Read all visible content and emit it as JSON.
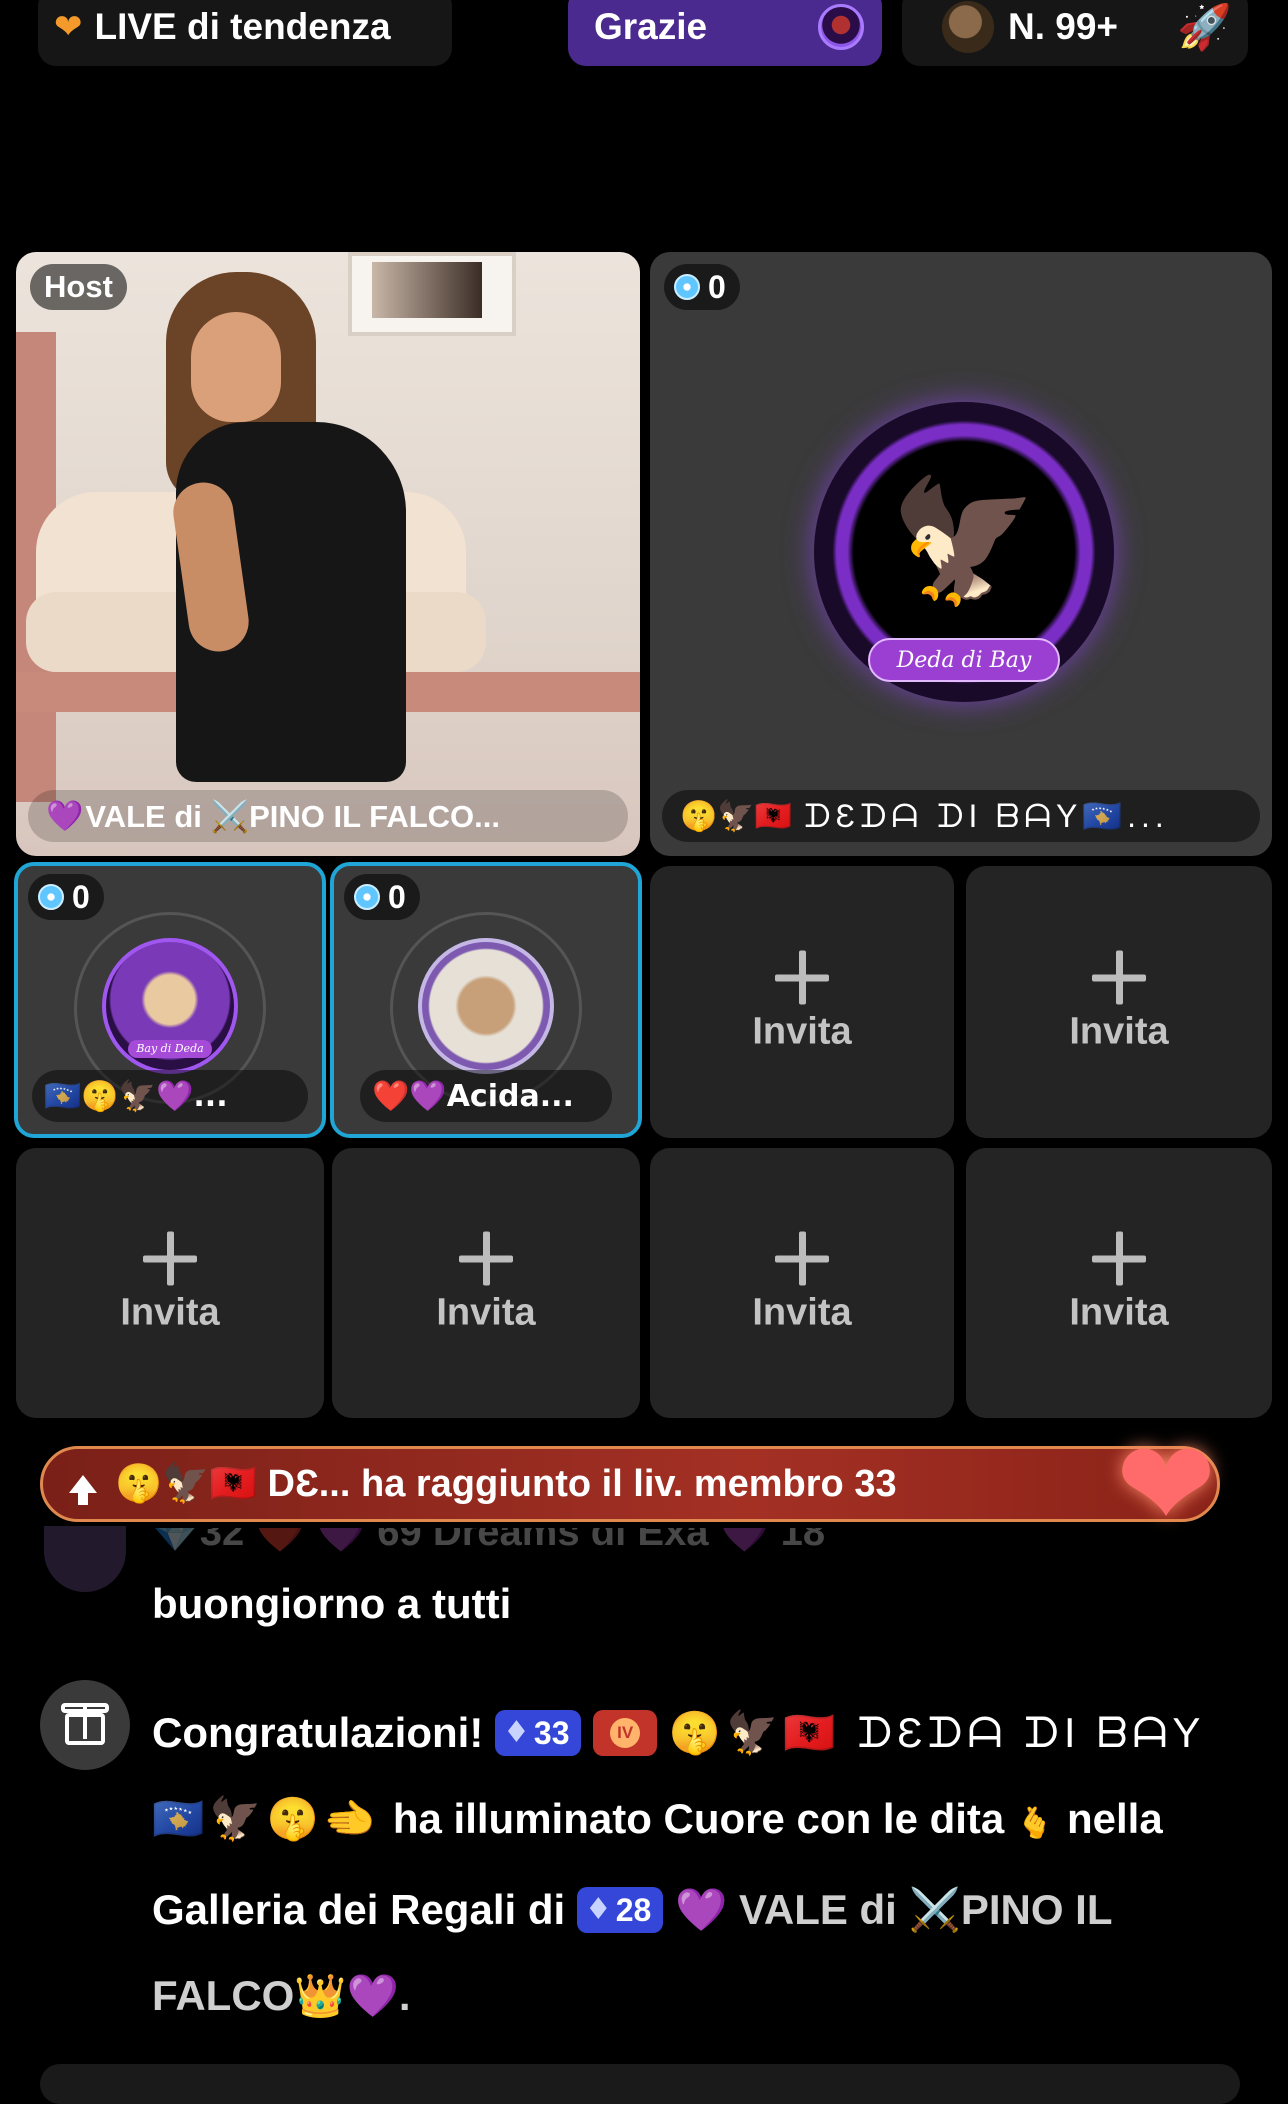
{
  "top_bar": {
    "trending_icon": "heart-icon",
    "trending_label": "LIVE di tendenza",
    "thanks_label": "Grazie",
    "rank_label": "N. 99+",
    "rank_icon": "rocket-icon"
  },
  "host_tile": {
    "tag": "Host",
    "name_prefix": "💜",
    "name": "VALE di ⚔️PINO IL FALCO..."
  },
  "cohost_tile": {
    "gems": "0",
    "name_emojis": "🤫🦅🇦🇱",
    "name": "ᗪƐᗪᗩ ᗪI ᗷᗩY🇽🇰...",
    "ribbon": "Deda di Bay"
  },
  "guests": [
    {
      "gems": "0",
      "name": "🇽🇰🤫🦅💜...",
      "ribbon": "Bay di Deda"
    },
    {
      "gems": "0",
      "name": "❤️💜Acida..."
    }
  ],
  "invite_label": "Invita",
  "banner": {
    "text": "🤫🦅🇦🇱 DƐ... ha raggiunto il liv. membro 33"
  },
  "chat": {
    "faded_row": "💎32 ❤️ 💜 69 Dreams di Exa 💜 18",
    "message": "buongiorno a tutti",
    "gift": {
      "title": "Congratulazioni!",
      "badge1": "33",
      "badge2": "IV",
      "sender": "🤫🦅🇦🇱 ᗪƐᗪᗩ ᗪI ᗷᗩY🇽🇰🦅🤫🫲",
      "text1": "ha illuminato Cuore con le dita",
      "text2": "nella Galleria dei Regali di",
      "badge3": "28",
      "recipient": "💜 VALE di ⚔️PINO IL FALCO👑💜."
    }
  },
  "colors": {
    "background": "#000000",
    "accent_purple": "#4b2a8f",
    "banner_red": "#a43024",
    "tile_dark": "#242424",
    "guest_border": "#1fa6d6"
  }
}
